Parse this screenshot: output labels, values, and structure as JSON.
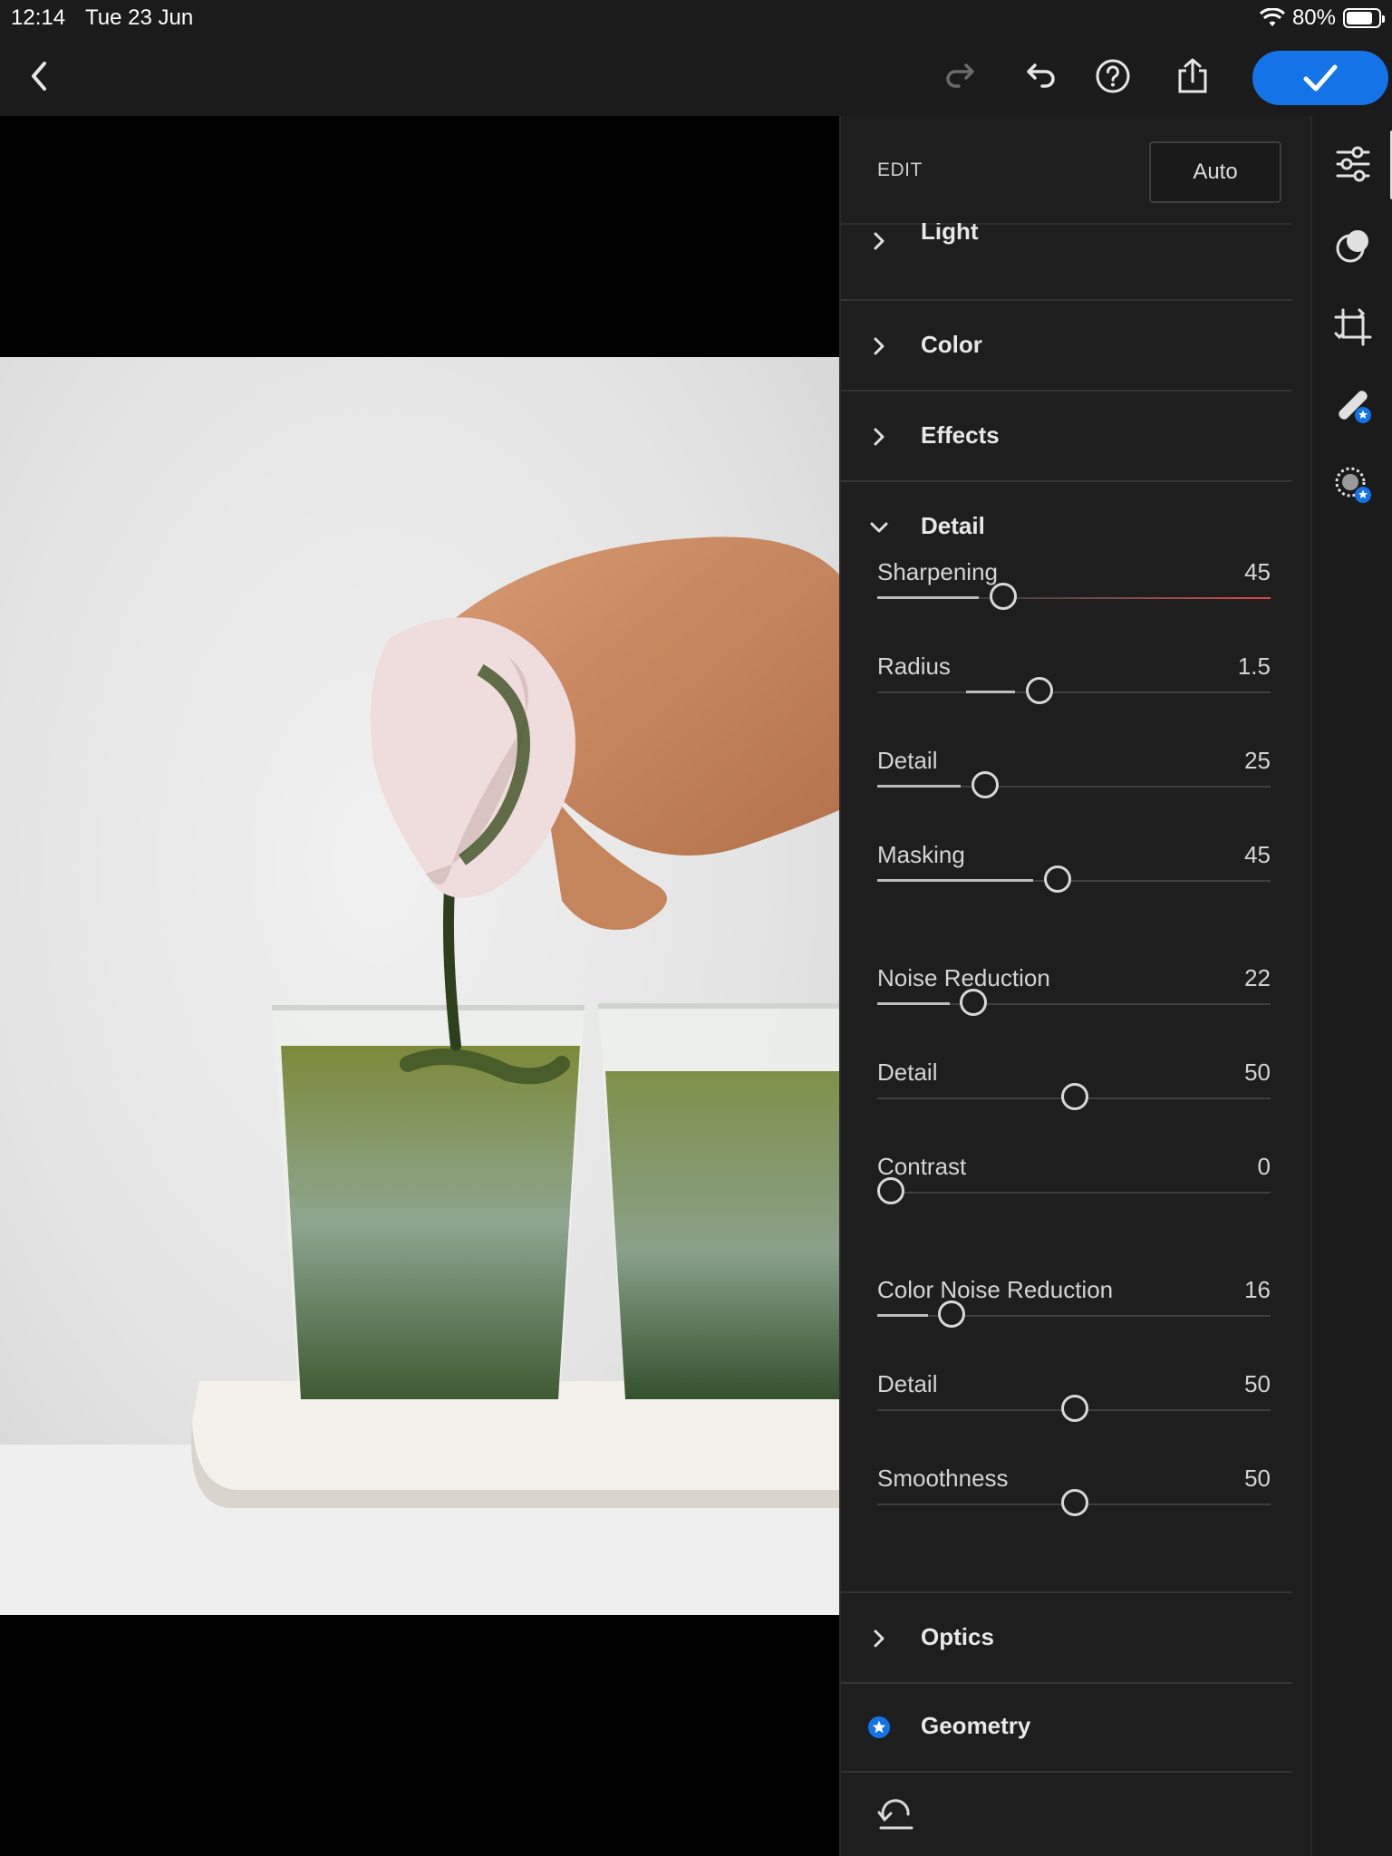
{
  "status_bar": {
    "time": "12:14",
    "date": "Tue 23 Jun",
    "battery": "80%",
    "battery_level": 0.8
  },
  "toolbar": {
    "icons": [
      "back-icon",
      "redo-icon",
      "undo-icon",
      "help-icon",
      "share-icon",
      "checkmark-icon"
    ],
    "accent": "#1473e6"
  },
  "panel": {
    "title": "EDIT",
    "auto_label": "Auto",
    "sections_collapsed_top": [
      {
        "label": "Light"
      },
      {
        "label": "Color"
      },
      {
        "label": "Effects"
      }
    ],
    "detail": {
      "label": "Detail",
      "sharpening": [
        {
          "name": "Sharpening",
          "value": "45"
        },
        {
          "name": "Radius",
          "value": "1.5"
        },
        {
          "name": "Detail",
          "value": "25"
        },
        {
          "name": "Masking",
          "value": "45"
        }
      ],
      "noise": [
        {
          "name": "Noise Reduction",
          "value": "22"
        },
        {
          "name": "Detail",
          "value": "50"
        },
        {
          "name": "Contrast",
          "value": "0"
        }
      ],
      "color_noise": [
        {
          "name": "Color Noise Reduction",
          "value": "16"
        },
        {
          "name": "Detail",
          "value": "50"
        },
        {
          "name": "Smoothness",
          "value": "50"
        }
      ]
    },
    "sections_bottom": [
      {
        "label": "Optics"
      },
      {
        "label": "Geometry",
        "premium": true
      }
    ]
  },
  "rail": {
    "icons": [
      "edit-sliders-icon",
      "presets-icon",
      "crop-icon",
      "healing-icon",
      "masking-icon"
    ]
  },
  "colors": {
    "premium_badge": "#1473e6",
    "sharpening_warning": "#e04a4a"
  }
}
